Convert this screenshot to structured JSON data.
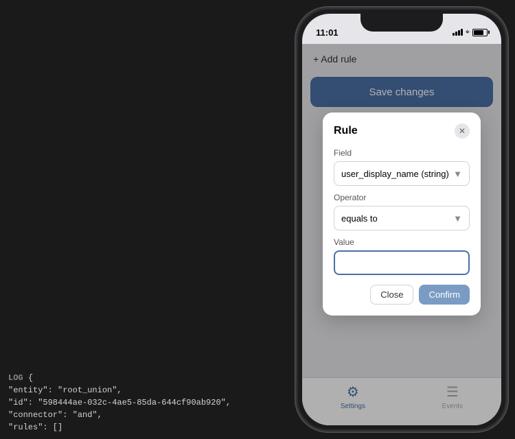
{
  "background_color": "#1a1a1a",
  "phone": {
    "status_bar": {
      "time": "11:01"
    },
    "add_rule": {
      "label": "+ Add rule"
    },
    "save_button": {
      "label": "Save changes"
    },
    "modal": {
      "title": "Rule",
      "field_label": "Field",
      "field_value": "user_display_name (string)",
      "operator_label": "Operator",
      "operator_value": "equals to",
      "value_label": "Value",
      "value_placeholder": "",
      "close_button": "Close",
      "confirm_button": "Confirm"
    },
    "tabs": [
      {
        "id": "settings",
        "label": "Settings",
        "active": true
      },
      {
        "id": "events",
        "label": "Events",
        "active": false
      }
    ]
  },
  "log": {
    "label": "LOG",
    "line1": "{",
    "line2": "  \"entity\": \"root_union\",",
    "line3": "  \"id\": \"598444ae-032c-4ae5-85da-644cf90ab920\",",
    "line4": "  \"connector\": \"and\",",
    "line5": "  \"rules\": []"
  }
}
